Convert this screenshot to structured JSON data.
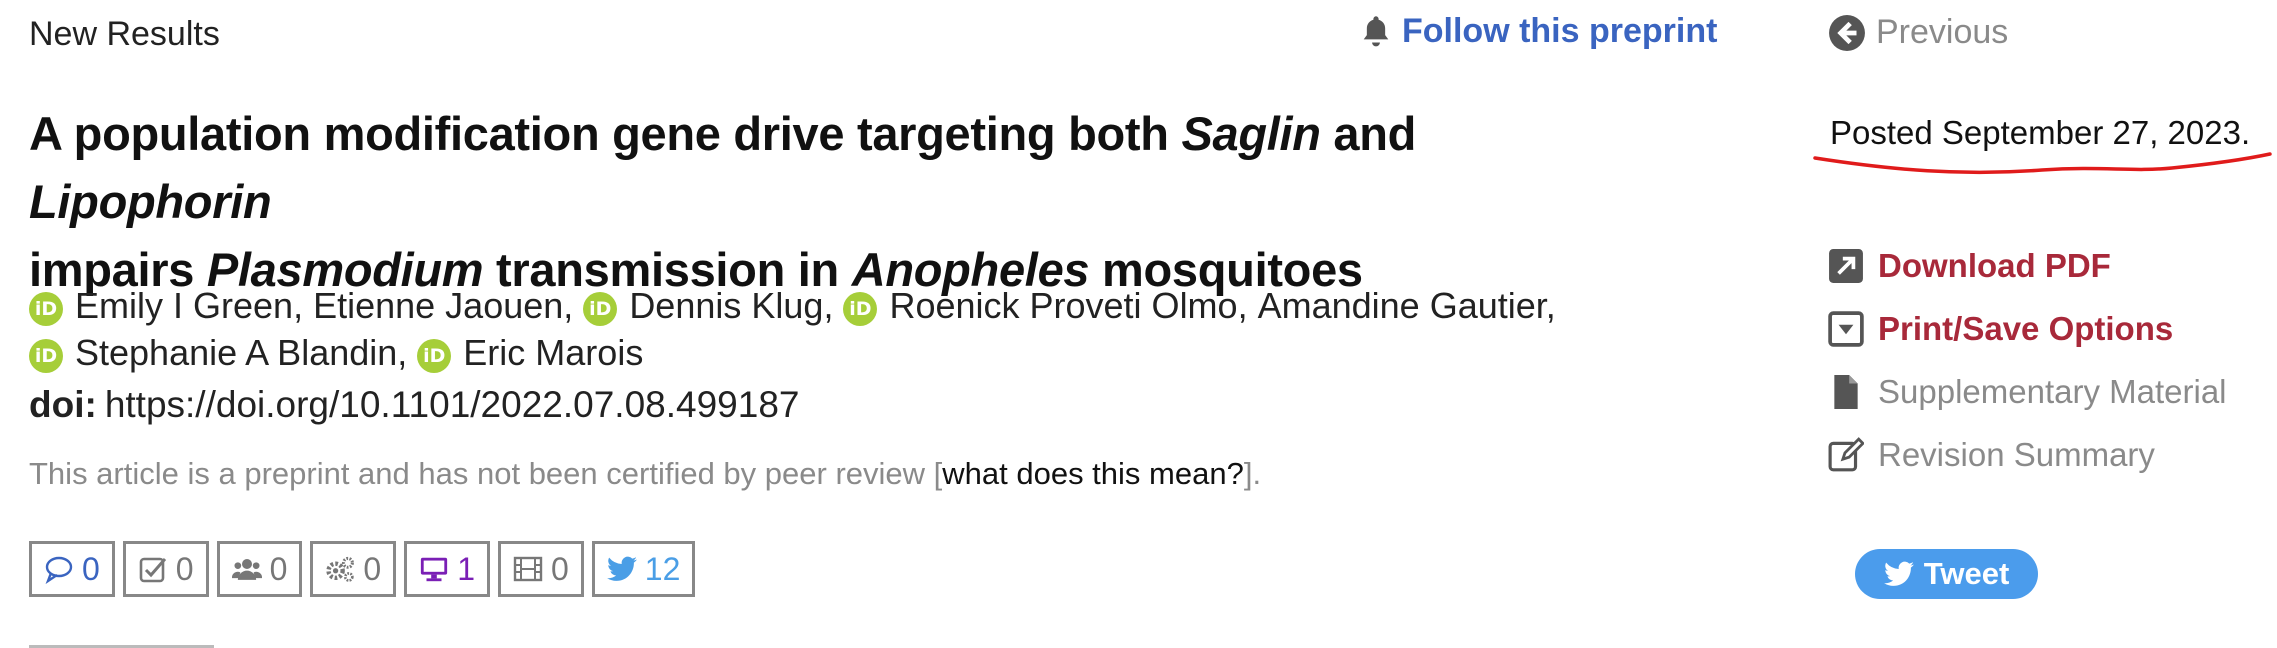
{
  "header": {
    "section_label": "New Results",
    "follow_label": "Follow this preprint",
    "previous_label": "Previous"
  },
  "article": {
    "title_parts": [
      "A population modification gene drive targeting both ",
      "Saglin",
      " and ",
      "Lipophorin",
      " impairs ",
      "Plasmodium",
      " transmission in ",
      "Anopheles",
      " mosquitoes"
    ],
    "authors": [
      {
        "name": "Emily I Green",
        "orcid": true,
        "sep": ","
      },
      {
        "name": "Etienne Jaouen",
        "orcid": false,
        "sep": ","
      },
      {
        "name": "Dennis Klug",
        "orcid": true,
        "sep": ","
      },
      {
        "name": "Roenick Proveti Olmo",
        "orcid": true,
        "sep": ","
      },
      {
        "name": "Amandine Gautier",
        "orcid": false,
        "sep": ","
      },
      {
        "name": "Stephanie A Blandin",
        "orcid": true,
        "sep": ","
      },
      {
        "name": "Eric Marois",
        "orcid": true,
        "sep": ""
      }
    ],
    "orcid_badge": "iD",
    "doi_label": "doi:",
    "doi_url": "https://doi.org/10.1101/2022.07.08.499187",
    "disclaimer_text": "This article is a preprint and has not been certified by peer review [",
    "disclaimer_link": "what does this mean?",
    "disclaimer_end": "]."
  },
  "metrics": [
    {
      "icon": "comment-icon",
      "count": "0",
      "tone": "blue"
    },
    {
      "icon": "check-square-icon",
      "count": "0",
      "tone": "gray"
    },
    {
      "icon": "users-icon",
      "count": "0",
      "tone": "gray"
    },
    {
      "icon": "gears-icon",
      "count": "0",
      "tone": "gray"
    },
    {
      "icon": "monitor-icon",
      "count": "1",
      "tone": "purple"
    },
    {
      "icon": "film-icon",
      "count": "0",
      "tone": "gray"
    },
    {
      "icon": "twitter-bird-icon",
      "count": "12",
      "tone": "tw"
    }
  ],
  "sidebar": {
    "posted": "Posted September 27, 2023.",
    "annotation_color": "#e01b1b",
    "actions": [
      {
        "label": "Download PDF",
        "icon": "external-link-icon",
        "style": "red"
      },
      {
        "label": "Print/Save Options",
        "icon": "caret-down-square-icon",
        "style": "red"
      },
      {
        "label": "Supplementary Material",
        "icon": "file-icon",
        "style": "gray"
      },
      {
        "label": "Revision Summary",
        "icon": "edit-icon",
        "style": "gray"
      }
    ],
    "tweet_label": "Tweet"
  },
  "colors": {
    "link_blue": "#3a64c0",
    "action_red": "#a8293a",
    "orcid_green": "#a6ce39",
    "tweet_blue": "#4b9cec"
  }
}
